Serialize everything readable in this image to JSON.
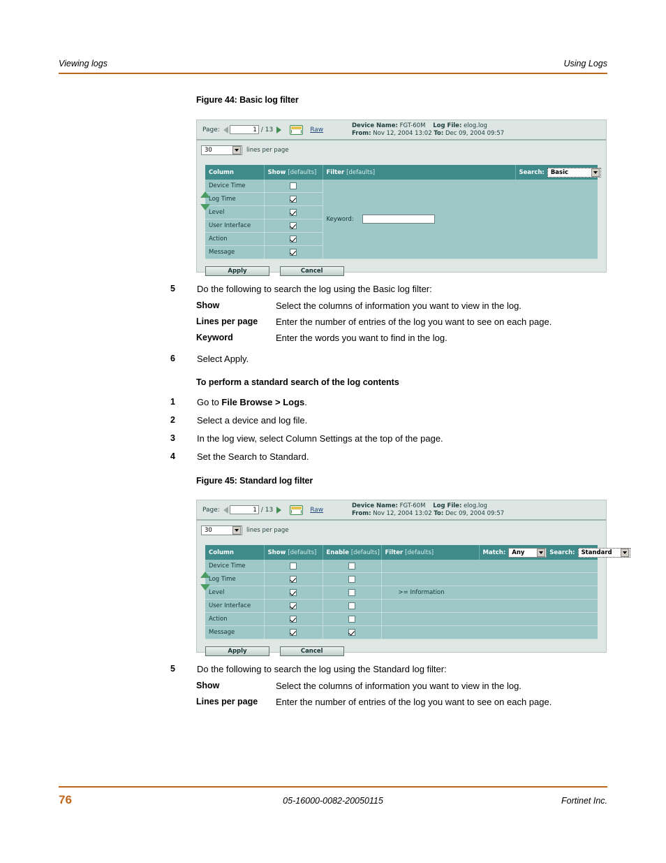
{
  "header": {
    "left": "Viewing logs",
    "right": "Using Logs"
  },
  "figures": {
    "basic": {
      "caption": "Figure 44: Basic log filter",
      "toolbar": {
        "page_label": "Page:",
        "page_value": "1",
        "page_total": "/ 13",
        "raw_link": "Raw",
        "device_name_label": "Device Name:",
        "device_name_value": "FGT-60M",
        "log_file_label": "Log File:",
        "log_file_value": "elog.log",
        "from_label": "From:",
        "from_value": "Nov 12, 2004 13:02",
        "to_label": "To:",
        "to_value": "Dec 09, 2004 09:57"
      },
      "lines_per_page": {
        "value": "30",
        "label": "lines per page"
      },
      "table": {
        "col_header": "Column",
        "show_header": "Show",
        "show_defaults": "[defaults]",
        "filter_header": "Filter",
        "filter_defaults": "[defaults]",
        "search_label": "Search:",
        "search_value": "Basic",
        "rows": [
          {
            "name": "Device Time",
            "show": false
          },
          {
            "name": "Log Time",
            "show": true
          },
          {
            "name": "Level",
            "show": true
          },
          {
            "name": "User Interface",
            "show": true
          },
          {
            "name": "Action",
            "show": true
          },
          {
            "name": "Message",
            "show": true
          }
        ],
        "keyword_label": "Keyword:",
        "keyword_value": ""
      },
      "buttons": {
        "apply": "Apply",
        "cancel": "Cancel"
      }
    },
    "standard": {
      "caption": "Figure 45: Standard log filter",
      "toolbar": {
        "page_label": "Page:",
        "page_value": "1",
        "page_total": "/ 13",
        "raw_link": "Raw",
        "device_name_label": "Device Name:",
        "device_name_value": "FGT-60M",
        "log_file_label": "Log File:",
        "log_file_value": "elog.log",
        "from_label": "From:",
        "from_value": "Nov 12, 2004 13:02",
        "to_label": "To:",
        "to_value": "Dec 09, 2004 09:57"
      },
      "lines_per_page": {
        "value": "30",
        "label": "lines per page"
      },
      "table": {
        "col_header": "Column",
        "show_header": "Show",
        "show_defaults": "[defaults]",
        "enable_header": "Enable",
        "enable_defaults": "[defaults]",
        "filter_header": "Filter",
        "filter_defaults": "[defaults]",
        "match_label": "Match:",
        "match_value": "Any",
        "search_label": "Search:",
        "search_value": "Standard",
        "rows": [
          {
            "name": "Device Time",
            "show": false,
            "enable": false,
            "filter": ""
          },
          {
            "name": "Log Time",
            "show": true,
            "enable": false,
            "filter": ""
          },
          {
            "name": "Level",
            "show": true,
            "enable": false,
            "filter": ">= Information"
          },
          {
            "name": "User Interface",
            "show": true,
            "enable": false,
            "filter": ""
          },
          {
            "name": "Action",
            "show": true,
            "enable": false,
            "filter": ""
          },
          {
            "name": "Message",
            "show": true,
            "enable": true,
            "filter": ""
          }
        ]
      },
      "buttons": {
        "apply": "Apply",
        "cancel": "Cancel"
      }
    }
  },
  "body": {
    "step5_basic": {
      "num": "5",
      "text": "Do the following to search the log using the Basic log filter:"
    },
    "defs_basic": [
      {
        "term": "Show",
        "desc": "Select the columns of information you want to view in the log."
      },
      {
        "term": "Lines per page",
        "desc": "Enter the number of entries of the log you want to see on each page."
      },
      {
        "term": "Keyword",
        "desc": "Enter the words you want to find in the log."
      }
    ],
    "step6": {
      "num": "6",
      "text": "Select Apply."
    },
    "procedure_heading": "To perform a standard search of the log contents",
    "step1": {
      "num": "1",
      "pre": "Go to ",
      "bold": "File Browse > Logs",
      "post": "."
    },
    "step2": {
      "num": "2",
      "text": "Select a device and log file."
    },
    "step3": {
      "num": "3",
      "text": "In the log view, select Column Settings at the top of the page."
    },
    "step4": {
      "num": "4",
      "text": "Set the Search to Standard."
    },
    "step5_standard": {
      "num": "5",
      "text": "Do the following to search the log using the Standard log filter:"
    },
    "defs_standard": [
      {
        "term": "Show",
        "desc": "Select the columns of information you want to view in the log."
      },
      {
        "term": "Lines per page",
        "desc": "Enter the number of entries of the log you want to see on each page."
      }
    ]
  },
  "footer": {
    "page_number": "76",
    "doc_id": "05-16000-0082-20050115",
    "company": "Fortinet Inc."
  },
  "colors": {
    "accent": "#c0661a",
    "table_header": "#3f8b8b",
    "table_body": "#9ec8c8"
  }
}
